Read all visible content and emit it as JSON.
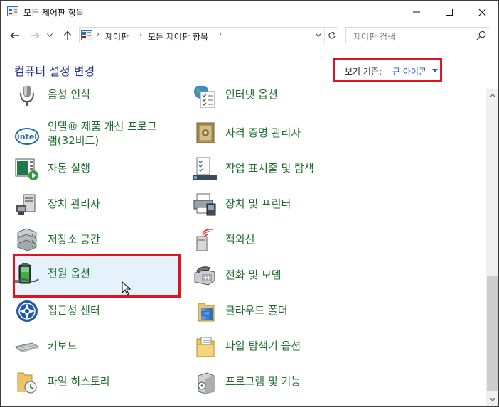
{
  "window": {
    "title": "모든 제어판 항목",
    "controls": [
      "minimize",
      "maximize",
      "close"
    ]
  },
  "nav": {
    "breadcrumbs": [
      "제어판",
      "모든 제어판 항목"
    ],
    "search_placeholder": "제어판 검색"
  },
  "header": {
    "title": "컴퓨터 설정 변경",
    "view_by_label": "보기 기준:",
    "view_by_value": "큰 아이콘"
  },
  "items": {
    "speech": "음성 인식",
    "internet_options": "인터넷 옵션",
    "intel_line1": "인텔® 제품 개선 프로그",
    "intel_line2": "램(32비트)",
    "credential_manager": "자격 증명 관리자",
    "autoplay": "자동 실행",
    "taskbar": "작업 표시줄 및 탐색",
    "device_manager": "장치 관리자",
    "devices_printers": "장치 및 프린터",
    "storage_spaces": "저장소 공간",
    "infrared": "적외선",
    "power_options": "전원 옵션",
    "phone_modem": "전화 및 모뎀",
    "ease_of_access": "접근성 센터",
    "cloud_folder": "클라우드 폴더",
    "keyboard": "키보드",
    "file_explorer_options": "파일 탐색기 옵션",
    "file_history": "파일 히스토리",
    "programs_features": "프로그램 및 기능"
  },
  "colors": {
    "item_text": "#1e6e2c",
    "header_text": "#1e3287",
    "link_blue": "#1d5fc5",
    "highlight_red": "#e0141e",
    "selected_bg": "#e5f2fb"
  },
  "icons": {
    "speech": "microphone-icon",
    "internet_options": "globe-checklist-icon",
    "intel": "intel-logo-icon",
    "credential_manager": "vault-icon",
    "autoplay": "autoplay-icon",
    "taskbar": "taskbar-icon",
    "device_manager": "device-manager-icon",
    "devices_printers": "printer-icon",
    "storage_spaces": "storage-drives-icon",
    "infrared": "infrared-icon",
    "power_options": "battery-power-icon",
    "phone_modem": "phone-modem-icon",
    "ease_of_access": "ease-of-access-icon",
    "cloud_folder": "cloud-folder-icon",
    "keyboard": "keyboard-icon",
    "file_explorer_options": "folder-options-icon",
    "file_history": "file-history-icon",
    "programs_features": "programs-box-icon"
  }
}
